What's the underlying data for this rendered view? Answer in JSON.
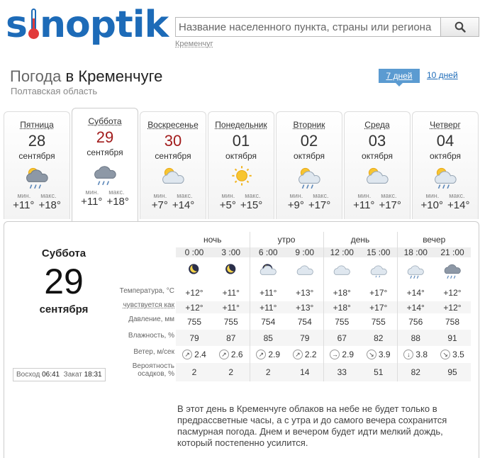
{
  "header": {
    "logo_text": "sinoptik",
    "search_placeholder": "Название населенного пункта, страны или региона",
    "search_icon": "magnifier-icon",
    "recent_city": "Кременчуг"
  },
  "title": {
    "prefix": "Погода",
    "city": "в Кременчуге",
    "region": "Полтавская область"
  },
  "range_tabs": {
    "seven": "7 дней",
    "ten": "10 дней"
  },
  "days": [
    {
      "name": "Пятница",
      "num": "28",
      "month": "сентября",
      "icon": "cloudy-sun-rain-icon",
      "min_label": "мин.",
      "max_label": "макс.",
      "min": "+11°",
      "max": "+18°",
      "weekend": false
    },
    {
      "name": "Суббота",
      "num": "29",
      "month": "сентября",
      "icon": "cloudy-rain-icon",
      "min_label": "мин.",
      "max_label": "макс.",
      "min": "+11°",
      "max": "+18°",
      "weekend": true
    },
    {
      "name": "Воскресенье",
      "num": "30",
      "month": "сентября",
      "icon": "sun-cloud-icon",
      "min_label": "мин.",
      "max_label": "макс.",
      "min": "+7°",
      "max": "+14°",
      "weekend": true
    },
    {
      "name": "Понедельник",
      "num": "01",
      "month": "октября",
      "icon": "sun-icon",
      "min_label": "мин.",
      "max_label": "макс.",
      "min": "+5°",
      "max": "+15°",
      "weekend": false
    },
    {
      "name": "Вторник",
      "num": "02",
      "month": "октября",
      "icon": "sun-cloud-rain-icon",
      "min_label": "мин.",
      "max_label": "макс.",
      "min": "+9°",
      "max": "+17°",
      "weekend": false
    },
    {
      "name": "Среда",
      "num": "03",
      "month": "октября",
      "icon": "sun-cloud-icon",
      "min_label": "мин.",
      "max_label": "макс.",
      "min": "+11°",
      "max": "+17°",
      "weekend": false
    },
    {
      "name": "Четверг",
      "num": "04",
      "month": "октября",
      "icon": "sun-cloud-rain-icon",
      "min_label": "мин.",
      "max_label": "макс.",
      "min": "+10°",
      "max": "+14°",
      "weekend": false
    }
  ],
  "detail": {
    "day_name": "Суббота",
    "day_num": "29",
    "month": "сентября",
    "sunrise_label": "Восход",
    "sunrise": "06:41",
    "sunset_label": "Закат",
    "sunset": "18:31",
    "periods": [
      "ночь",
      "утро",
      "день",
      "вечер"
    ],
    "row_labels": {
      "temp": "Температура, °C",
      "feels": "чувствуется как",
      "pressure": "Давление, мм",
      "humidity": "Влажность, %",
      "wind": "Ветер, м/сек",
      "precip1": "Вероятность",
      "precip2": "осадков, %"
    },
    "hours": [
      "0 :00",
      "3 :00",
      "6 :00",
      "9 :00",
      "12 :00",
      "15 :00",
      "18 :00",
      "21 :00"
    ],
    "icons": [
      "moon-cloud-icon",
      "moon-cloud-icon",
      "moon-storm-cloud-icon",
      "cloud-icon",
      "cloud-icon",
      "cloud-drizzle-icon",
      "cloud-rain-icon",
      "dark-cloud-rain-icon"
    ],
    "temps": [
      "+12°",
      "+11°",
      "+11°",
      "+13°",
      "+18°",
      "+17°",
      "+14°",
      "+12°"
    ],
    "feels": [
      "+12°",
      "+11°",
      "+11°",
      "+13°",
      "+18°",
      "+17°",
      "+14°",
      "+12°"
    ],
    "pressure": [
      "755",
      "755",
      "754",
      "754",
      "755",
      "755",
      "756",
      "758"
    ],
    "humidity": [
      "79",
      "87",
      "85",
      "79",
      "67",
      "82",
      "88",
      "91"
    ],
    "wind_dir": [
      "↗",
      "↗",
      "↗",
      "↗",
      "→",
      "↘",
      "↓",
      "↘"
    ],
    "wind": [
      "2.4",
      "2.6",
      "2.9",
      "2.2",
      "2.9",
      "3.9",
      "3.8",
      "3.5"
    ],
    "precip": [
      "2",
      "2",
      "2",
      "14",
      "33",
      "51",
      "82",
      "95"
    ],
    "description": "В этот день в Кременчуге облаков на небе не будет только в предрассветные часы, а с утра и до самого вечера сохранится пасмурная погода. Днем и вечером будет идти мелкий дождь, который постепенно усилится."
  },
  "colors": {
    "brand": "#1d6bb8",
    "weekend": "#a21c1c",
    "tab": "#5b9bd1"
  }
}
